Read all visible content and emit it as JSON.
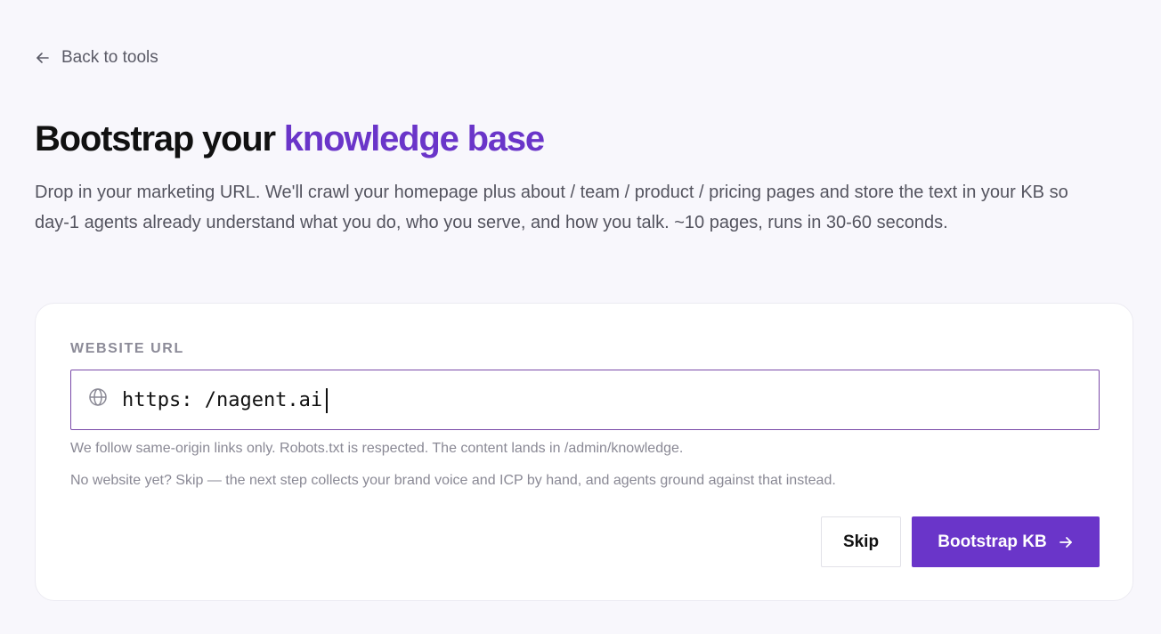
{
  "nav": {
    "back_label": "Back to tools",
    "back_icon": "arrow-left-icon"
  },
  "header": {
    "title_prefix": "Bootstrap your ",
    "title_accent": "knowledge base",
    "accent_color": "#6a35c9",
    "description": "Drop in your marketing URL. We'll crawl your homepage plus about / team / product / pricing pages and store the text in your KB so day-1 agents already understand what you do, who you serve, and how you talk. ~10 pages, runs in 30-60 seconds."
  },
  "form": {
    "label": "WEBSITE URL",
    "input_icon": "globe-icon",
    "url_value": "https: /nagent.ai",
    "hint_1": "We follow same-origin links only. Robots.txt is respected. The content lands in /admin/knowledge.",
    "hint_2": "No website yet? Skip — the next step collects your brand voice and ICP by hand, and agents ground against that instead."
  },
  "actions": {
    "skip_label": "Skip",
    "bootstrap_label": "Bootstrap KB",
    "bootstrap_icon": "arrow-right-icon",
    "primary_color": "#6a35c9"
  }
}
